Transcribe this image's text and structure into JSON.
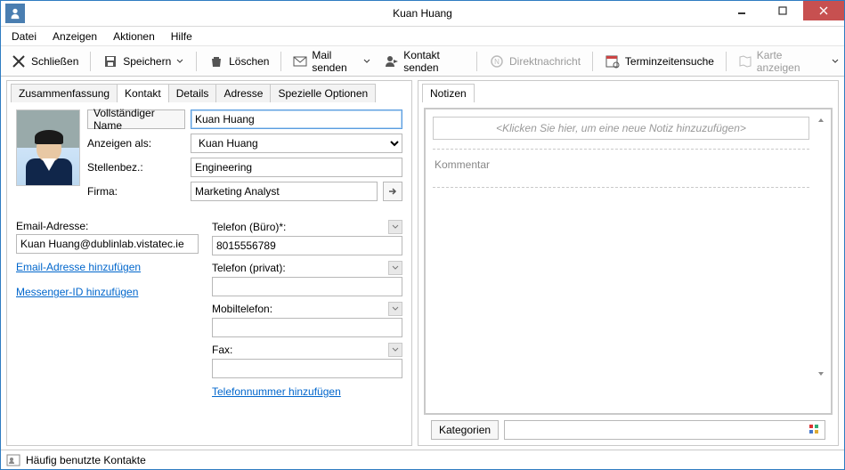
{
  "window": {
    "title": "Kuan Huang"
  },
  "menu": {
    "items": [
      "Datei",
      "Anzeigen",
      "Aktionen",
      "Hilfe"
    ]
  },
  "toolbar": {
    "close": "Schließen",
    "save": "Speichern",
    "delete": "Löschen",
    "mail": "Mail senden",
    "contact": "Kontakt senden",
    "dm": "Direktnachricht",
    "timesearch": "Terminzeitensuche",
    "map": "Karte anzeigen"
  },
  "tabs": {
    "left": [
      "Zusammenfassung",
      "Kontakt",
      "Details",
      "Adresse",
      "Spezielle Optionen"
    ],
    "left_active": 1,
    "right": [
      "Notizen"
    ],
    "right_active": 0
  },
  "contact": {
    "fullname_btn": "Vollständiger Name",
    "fullname_value": "Kuan Huang",
    "displayas_label": "Anzeigen als:",
    "displayas_value": "Kuan Huang",
    "jobtitle_label": "Stellenbez.:",
    "jobtitle_value": "Engineering",
    "company_label": "Firma:",
    "company_value": "Marketing Analyst",
    "email_label": "Email-Adresse:",
    "email_value": "Kuan Huang@dublinlab.vistatec.ie",
    "add_email_link": "Email-Adresse hinzufügen",
    "add_messenger_link": "Messenger-ID hinzufügen",
    "phone_office_label": "Telefon (Büro)*:",
    "phone_office_value": "8015556789",
    "phone_home_label": "Telefon (privat):",
    "phone_home_value": "",
    "mobile_label": "Mobiltelefon:",
    "mobile_value": "",
    "fax_label": "Fax:",
    "fax_value": "",
    "add_phone_link": "Telefonnummer hinzufügen"
  },
  "notes": {
    "placeholder": "<Klicken Sie hier, um eine neue Notiz hinzuzufügen>",
    "comment_heading": "Kommentar",
    "categories_btn": "Kategorien"
  },
  "status": {
    "text": "Häufig benutzte Kontakte"
  }
}
